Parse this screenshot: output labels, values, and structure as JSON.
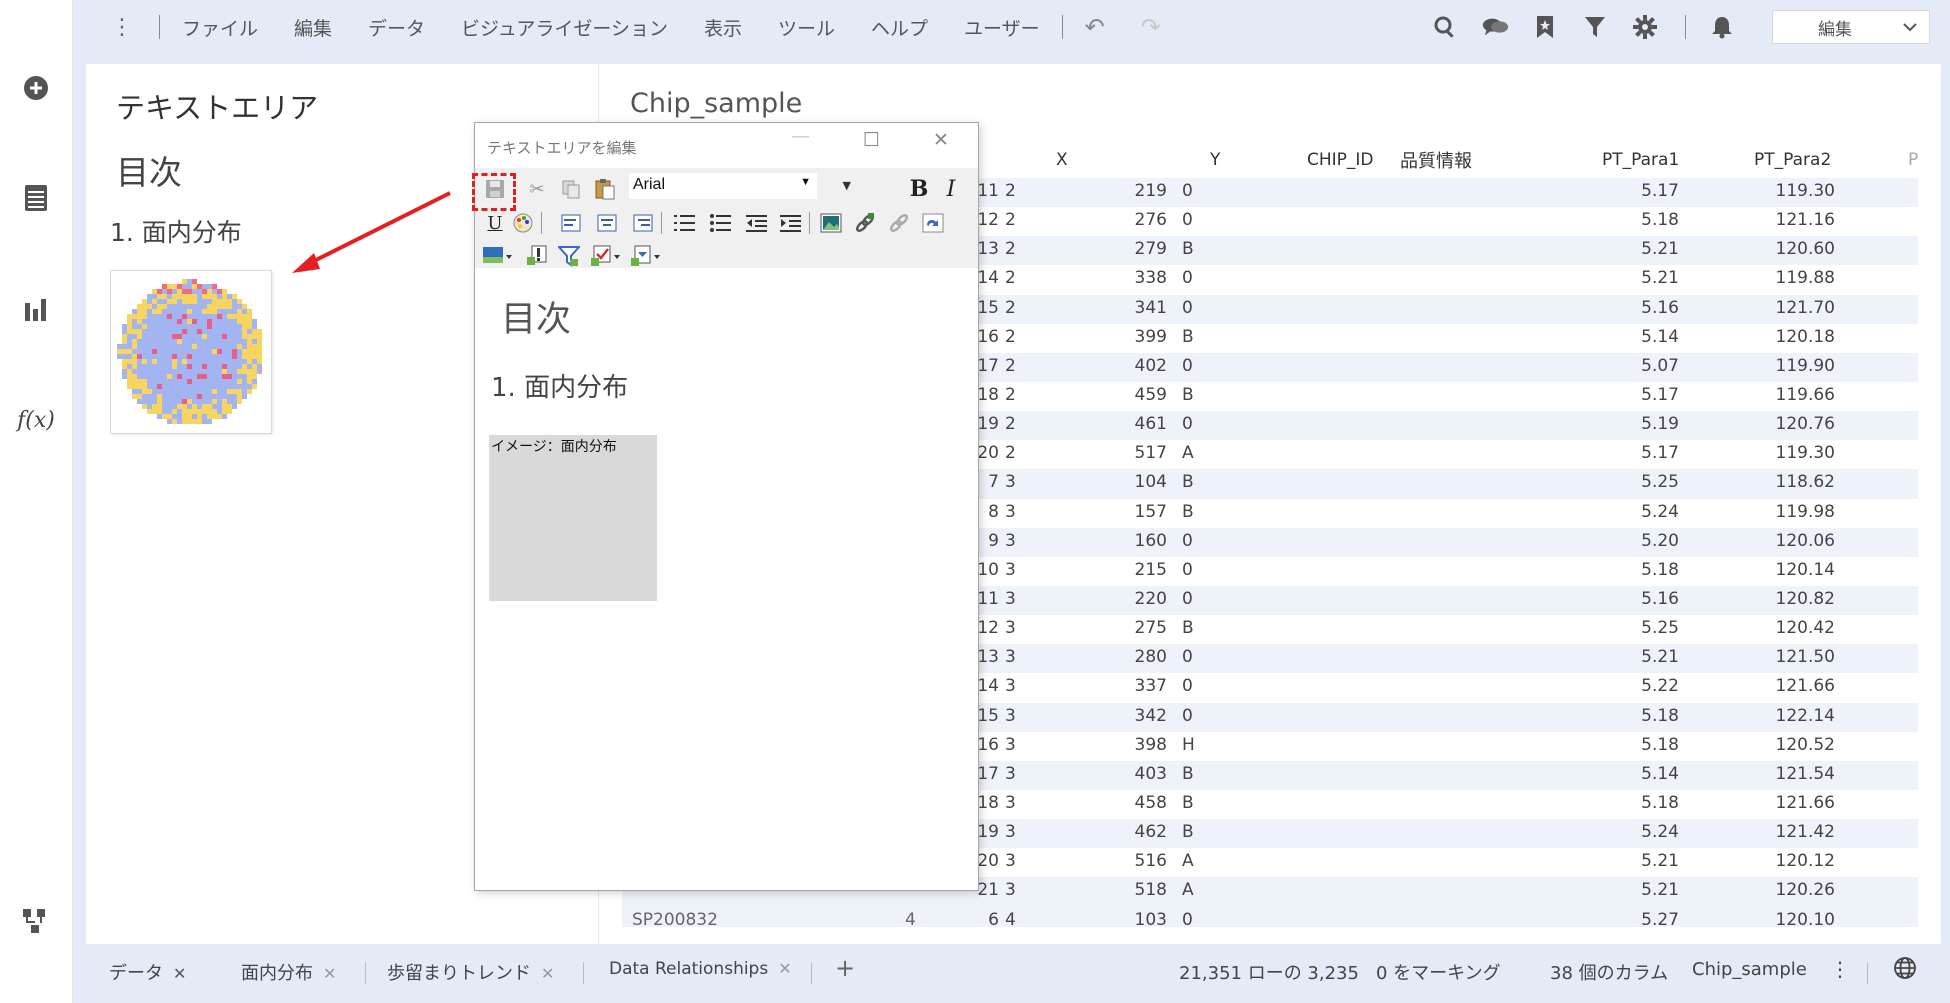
{
  "menu": {
    "items": [
      "ファイル",
      "編集",
      "データ",
      "ビジュアライゼーション",
      "表示",
      "ツール",
      "ヘルプ",
      "ユーザー"
    ],
    "mode_select": "編集"
  },
  "rail_icons": [
    "add-icon",
    "data-panel-icon",
    "visualization-icon",
    "function-icon",
    "data-canvas-icon"
  ],
  "textarea": {
    "title": "テキストエリア",
    "heading": "目次",
    "subheading": "1. 面内分布"
  },
  "editor": {
    "title": "テキストエリアを編集",
    "font": "Arial",
    "heading": "目次",
    "subheading": "1. 面内分布",
    "image_placeholder": "イメージ：面内分布"
  },
  "table": {
    "title": "Chip_sample",
    "headers": {
      "x": "X",
      "y": "Y",
      "chip_id": "CHIP_ID",
      "quality": "品質情報",
      "p1": "PT_Para1",
      "p2": "PT_Para2",
      "more": "P"
    },
    "rows": [
      [
        "2",
        "11",
        "219",
        "0",
        "5.17",
        "119.30"
      ],
      [
        "2",
        "12",
        "276",
        "0",
        "5.18",
        "121.16"
      ],
      [
        "2",
        "13",
        "279",
        "B",
        "5.21",
        "120.60"
      ],
      [
        "2",
        "14",
        "338",
        "0",
        "5.21",
        "119.88"
      ],
      [
        "2",
        "15",
        "341",
        "0",
        "5.16",
        "121.70"
      ],
      [
        "2",
        "16",
        "399",
        "B",
        "5.14",
        "120.18"
      ],
      [
        "2",
        "17",
        "402",
        "0",
        "5.07",
        "119.90"
      ],
      [
        "2",
        "18",
        "459",
        "B",
        "5.17",
        "119.66"
      ],
      [
        "2",
        "19",
        "461",
        "0",
        "5.19",
        "120.76"
      ],
      [
        "2",
        "20",
        "517",
        "A",
        "5.17",
        "119.30"
      ],
      [
        "3",
        "7",
        "104",
        "B",
        "5.25",
        "118.62"
      ],
      [
        "3",
        "8",
        "157",
        "B",
        "5.24",
        "119.98"
      ],
      [
        "3",
        "9",
        "160",
        "0",
        "5.20",
        "120.06"
      ],
      [
        "3",
        "10",
        "215",
        "0",
        "5.18",
        "120.14"
      ],
      [
        "3",
        "11",
        "220",
        "0",
        "5.16",
        "120.82"
      ],
      [
        "3",
        "12",
        "275",
        "B",
        "5.25",
        "120.42"
      ],
      [
        "3",
        "13",
        "280",
        "0",
        "5.21",
        "121.50"
      ],
      [
        "3",
        "14",
        "337",
        "0",
        "5.22",
        "121.66"
      ],
      [
        "3",
        "15",
        "342",
        "0",
        "5.18",
        "122.14"
      ],
      [
        "3",
        "16",
        "398",
        "H",
        "5.18",
        "120.52"
      ],
      [
        "3",
        "17",
        "403",
        "B",
        "5.14",
        "121.54"
      ],
      [
        "3",
        "18",
        "458",
        "B",
        "5.18",
        "121.66"
      ],
      [
        "3",
        "19",
        "462",
        "B",
        "5.24",
        "121.42"
      ],
      [
        "3",
        "20",
        "516",
        "A",
        "5.21",
        "120.12"
      ],
      [
        "3",
        "21",
        "518",
        "A",
        "5.21",
        "120.26"
      ]
    ],
    "last_row": {
      "a": "SP200832",
      "b": "4",
      "x": "4",
      "y": "6",
      "chip_id": "103",
      "q": "0",
      "p1": "5.27",
      "p2": "120.10"
    }
  },
  "tabs": [
    {
      "label": "データ",
      "active": true
    },
    {
      "label": "面内分布",
      "active": false
    },
    {
      "label": "歩留まりトレンド",
      "active": false
    },
    {
      "label": "Data Relationships",
      "active": false
    }
  ],
  "status": {
    "rows": "21,351 ローの 3,235",
    "marked": "0 をマーキング",
    "columns": "38 個のカラム",
    "table": "Chip_sample"
  },
  "colors": {
    "accent_bar": "#e4ebf7",
    "highlight": "#e02020",
    "row_alt": "#eef2f9"
  }
}
